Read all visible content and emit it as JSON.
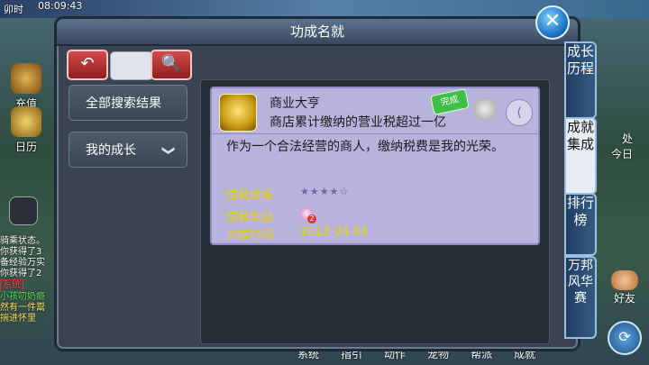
{
  "hud": {
    "daytime": "卯时",
    "clock": "08:09:43",
    "left_buttons": [
      "充值",
      "日历"
    ],
    "right_labels": [
      "处",
      "今日",
      "好友"
    ],
    "bottom_bar": [
      "系统",
      "指引",
      "动作",
      "宠物",
      "帮派",
      "成就"
    ],
    "chat_lines": [
      "骑乘状态。",
      "你获得了3",
      "备经验万实",
      "你获得了2"
    ],
    "chat_system_tag": "系统",
    "chat_green": "小孩叨奶瘾",
    "chat_yellow": [
      "然有一件鬻",
      "揣进怀里"
    ]
  },
  "panel": {
    "title": "功成名就",
    "close_glyph": "✕",
    "back_glyph": "↶",
    "search_glyph": "🔍",
    "search_value": "",
    "left_items": [
      {
        "label": "全部搜索结果"
      },
      {
        "label": "我的成长",
        "chevron": "❯"
      }
    ]
  },
  "achievement": {
    "name": "商业大亨",
    "condition": "商店累计缴纳的营业税超过一亿",
    "status": "完成",
    "description": "作为一个合法经营的商人，缴纳税费是我的光荣。",
    "difficulty_label": "成就难度",
    "difficulty_stars": "★★★★☆",
    "difficulty_value": 4,
    "reward_label": "成就奖励",
    "reward_count": "2",
    "date_label": "达成时间",
    "date_value": "2013-04-04"
  },
  "side_tabs": [
    "成长历程",
    "成就集成",
    "排行榜",
    "万邦风华赛"
  ],
  "active_tab_index": 1
}
